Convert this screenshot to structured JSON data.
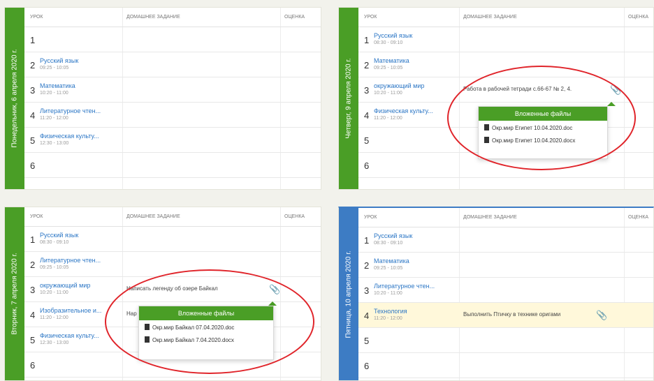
{
  "headers": {
    "lesson": "УРОК",
    "homework": "ДОМАШНЕЕ ЗАДАНИЕ",
    "grade": "ОЦЕНКА"
  },
  "days": [
    {
      "title": "Понедельник, 6 апреля 2020 г.",
      "rows": [
        {
          "num": "1",
          "subject": "",
          "time": "",
          "homework": ""
        },
        {
          "num": "2",
          "subject": "Русский язык",
          "time": "09:25 - 10:05",
          "homework": ""
        },
        {
          "num": "3",
          "subject": "Математика",
          "time": "10:20 - 11:00",
          "homework": ""
        },
        {
          "num": "4",
          "subject": "Литературное чтен...",
          "time": "11:20 - 12:00",
          "homework": ""
        },
        {
          "num": "5",
          "subject": "Физическая культу...",
          "time": "12:30 - 13:00",
          "homework": ""
        },
        {
          "num": "6",
          "subject": "",
          "time": "",
          "homework": ""
        }
      ]
    },
    {
      "title": "Четверг, 9 апреля 2020 г.",
      "rows": [
        {
          "num": "1",
          "subject": "Русский язык",
          "time": "08:30 - 09:10",
          "homework": ""
        },
        {
          "num": "2",
          "subject": "Математика",
          "time": "09:25 - 10:05",
          "homework": ""
        },
        {
          "num": "3",
          "subject": "окружающий мир",
          "time": "10:20 - 11:00",
          "homework": "Работа в рабочей тетради с.66-67 № 2, 4."
        },
        {
          "num": "4",
          "subject": "Физическая культу...",
          "time": "11:20 - 12:00",
          "homework": ""
        },
        {
          "num": "5",
          "subject": "",
          "time": "",
          "homework": ""
        },
        {
          "num": "6",
          "subject": "",
          "time": "",
          "homework": ""
        }
      ],
      "attachments": {
        "title": "Вложенные файлы",
        "files": [
          "Окр.мир Египет 10.04.2020.doc",
          "Окр.мир Египет 10.04.2020.docx"
        ]
      }
    },
    {
      "title": "Вторник, 7 апреля 2020 г.",
      "rows": [
        {
          "num": "1",
          "subject": "Русский язык",
          "time": "08:30 - 09:10",
          "homework": ""
        },
        {
          "num": "2",
          "subject": "Литературное чтен...",
          "time": "09:25 - 10:05",
          "homework": ""
        },
        {
          "num": "3",
          "subject": "окружающий мир",
          "time": "10:20 - 11:00",
          "homework": "Написать легенду об озере Байкал"
        },
        {
          "num": "4",
          "subject": "Изобразительное и...",
          "time": "11:20 - 12:00",
          "homework": "Нар"
        },
        {
          "num": "5",
          "subject": "Физическая культу...",
          "time": "12:30 - 13:00",
          "homework": ""
        },
        {
          "num": "6",
          "subject": "",
          "time": "",
          "homework": ""
        }
      ],
      "attachments": {
        "title": "Вложенные файлы",
        "files": [
          "Окр.мир Байкал 07.04.2020.doc",
          "Окр.мир Байкал 7.04.2020.docx"
        ]
      }
    },
    {
      "title": "Пятница, 10 апреля 2020 г.",
      "rows": [
        {
          "num": "1",
          "subject": "Русский язык",
          "time": "08:30 - 09:10",
          "homework": ""
        },
        {
          "num": "2",
          "subject": "Математика",
          "time": "09:25 - 10:05",
          "homework": ""
        },
        {
          "num": "3",
          "subject": "Литературное чтен...",
          "time": "10:20 - 11:00",
          "homework": ""
        },
        {
          "num": "4",
          "subject": "Технология",
          "time": "11:20 - 12:00",
          "homework": "Выполнить Птичку в технике оригами"
        },
        {
          "num": "5",
          "subject": "",
          "time": "",
          "homework": ""
        },
        {
          "num": "6",
          "subject": "",
          "time": "",
          "homework": ""
        }
      ]
    }
  ],
  "colors": {
    "green": "#4a9e26",
    "blue": "#3d7cc4",
    "link": "#2b76c5",
    "highlight": "#fff8da",
    "circle": "#e0242a"
  },
  "icons": {
    "attachment": "paperclip-icon",
    "file": "document-icon"
  }
}
